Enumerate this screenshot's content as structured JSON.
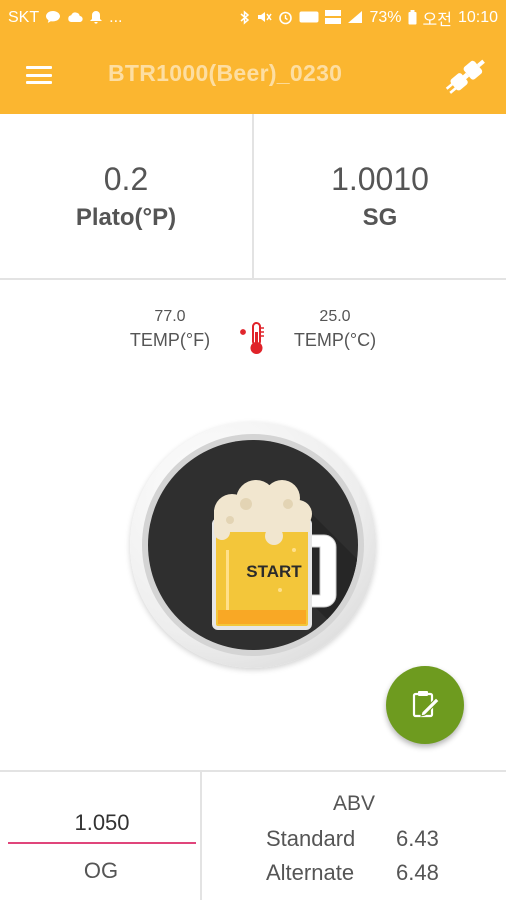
{
  "status_bar": {
    "carrier": "SKT",
    "more": "...",
    "battery": "73%",
    "ampm": "오전",
    "time": "10:10",
    "icons_left": [
      "chat-bubble-icon",
      "cloud-icon",
      "bell-icon"
    ],
    "icons_right": [
      "bluetooth-icon",
      "mute-icon",
      "alarm-icon",
      "hd-icon",
      "lte-icon",
      "signal-icon",
      "battery-icon"
    ]
  },
  "app_bar": {
    "title": "BTR1000(Beer)_0230",
    "color": "#fbb630"
  },
  "readings": {
    "plato": {
      "value": "0.2",
      "unit": "Plato(°P)"
    },
    "sg": {
      "value": "1.0010",
      "unit": "SG"
    }
  },
  "temps": {
    "fahrenheit": {
      "value": "77.0",
      "label": "TEMP(°F)"
    },
    "celsius": {
      "value": "25.0",
      "label": "TEMP(°C)"
    }
  },
  "start_button": {
    "label": "START"
  },
  "fab": {
    "icon": "clipboard-edit-icon",
    "color": "#6e9b1f"
  },
  "og": {
    "value": "1.050",
    "label": "OG"
  },
  "abv": {
    "title": "ABV",
    "rows": [
      {
        "label": "Standard",
        "value": "6.43"
      },
      {
        "label": "Alternate",
        "value": "6.48"
      }
    ]
  }
}
